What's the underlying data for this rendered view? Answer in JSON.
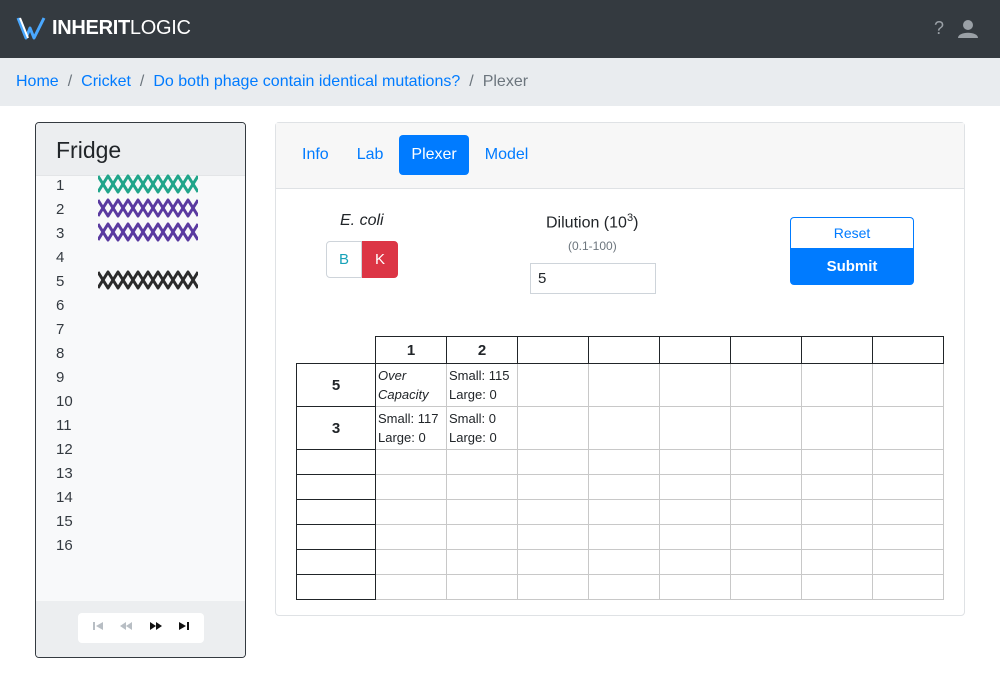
{
  "header": {
    "logo_bold": "INHERIT",
    "logo_light": "LOGIC",
    "help_label": "?",
    "colors": {
      "bar": "#343a40",
      "accent": "#007bff"
    }
  },
  "breadcrumb": [
    {
      "label": "Home"
    },
    {
      "label": "Cricket"
    },
    {
      "label": "Do both phage contain identical mutations?"
    },
    {
      "label": "Plexer"
    }
  ],
  "fridge": {
    "title": "Fridge",
    "slots": [
      {
        "num": "1",
        "phage": "teal"
      },
      {
        "num": "2",
        "phage": "purple"
      },
      {
        "num": "3",
        "phage": "purple"
      },
      {
        "num": "4",
        "phage": ""
      },
      {
        "num": "5",
        "phage": "black"
      },
      {
        "num": "6",
        "phage": ""
      },
      {
        "num": "7",
        "phage": ""
      },
      {
        "num": "8",
        "phage": ""
      },
      {
        "num": "9",
        "phage": ""
      },
      {
        "num": "10",
        "phage": ""
      },
      {
        "num": "11",
        "phage": ""
      },
      {
        "num": "12",
        "phage": ""
      },
      {
        "num": "13",
        "phage": ""
      },
      {
        "num": "14",
        "phage": ""
      },
      {
        "num": "15",
        "phage": ""
      },
      {
        "num": "16",
        "phage": ""
      }
    ],
    "phage_colors": {
      "teal": "#20a58a",
      "purple": "#5a3aa0",
      "black": "#2b2b2b"
    },
    "pager_icons": [
      "first-page-icon",
      "prev-page-icon",
      "next-page-icon",
      "last-page-icon"
    ]
  },
  "tabs": [
    {
      "label": "Info",
      "active": false
    },
    {
      "label": "Lab",
      "active": false
    },
    {
      "label": "Plexer",
      "active": true
    },
    {
      "label": "Model",
      "active": false
    }
  ],
  "plexer": {
    "ecoli_label": "E. coli",
    "strain_b": "B",
    "strain_k": "K",
    "selected_strain": "K",
    "dilution_label": "Dilution (10",
    "dilution_exp": "3",
    "dilution_close": ")",
    "dilution_range": "(0.1-100)",
    "dilution_value": "5",
    "reset_label": "Reset",
    "submit_label": "Submit",
    "col_headers": [
      "1",
      "2",
      "",
      "",
      "",
      "",
      "",
      ""
    ],
    "rows": [
      {
        "label": "5",
        "cells": [
          {
            "line1": "Over",
            "line2": "Capacity",
            "italic": true
          },
          {
            "line1": "Small: 115",
            "line2": "Large: 0",
            "italic": false
          }
        ]
      },
      {
        "label": "3",
        "cells": [
          {
            "line1": "Small: 117",
            "line2": "Large: 0",
            "italic": false
          },
          {
            "line1": "Small: 0",
            "line2": "Large: 0",
            "italic": false
          }
        ]
      }
    ],
    "empty_rows": 6
  }
}
